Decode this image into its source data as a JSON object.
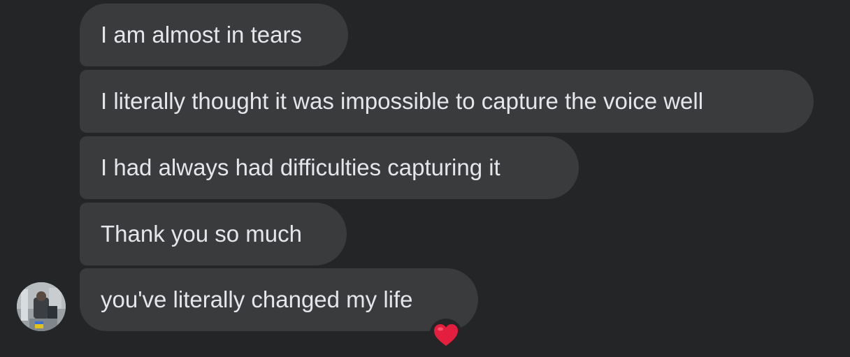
{
  "messages": [
    {
      "text": "I am almost in tears"
    },
    {
      "text": "I literally thought it was impossible to capture the voice well"
    },
    {
      "text": "I had always had difficulties capturing it"
    },
    {
      "text": "Thank you so much"
    },
    {
      "text": "you've literally changed my life",
      "reaction": "heart-icon"
    }
  ],
  "sender": {
    "avatar_icon": "avatar-photo"
  },
  "colors": {
    "background": "#242526",
    "bubble": "#3a3b3c",
    "text": "#e4e6eb",
    "heart": "#e41e3f"
  }
}
